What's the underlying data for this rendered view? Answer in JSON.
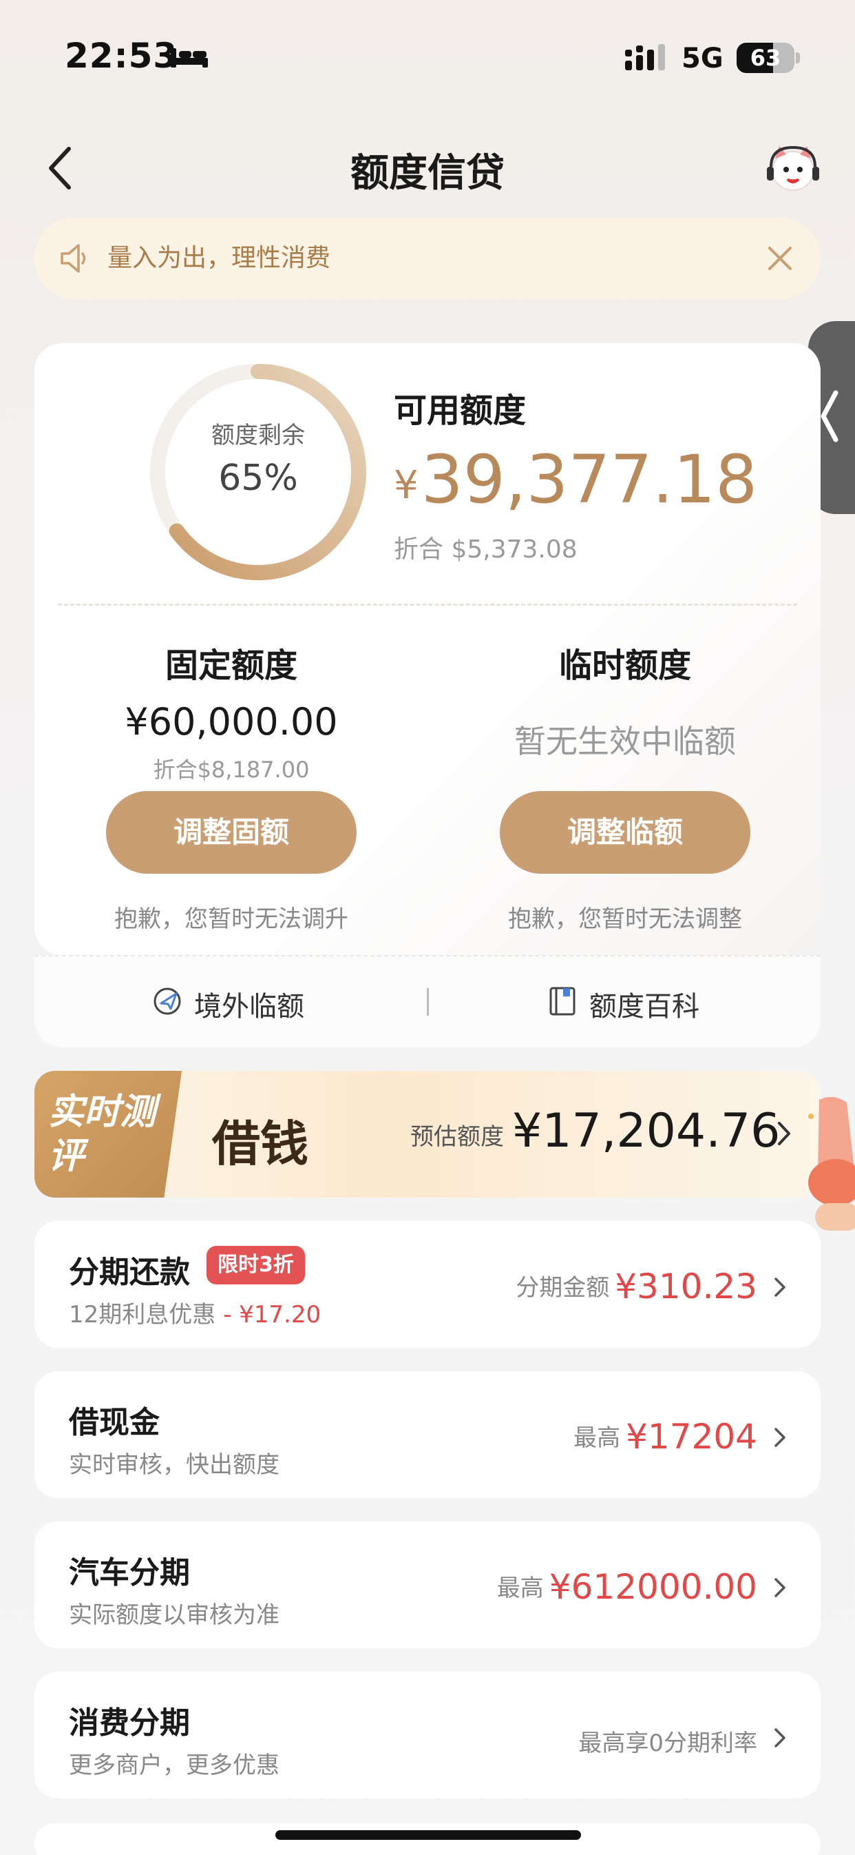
{
  "status_bar": {
    "time": "22:53",
    "network": "5G",
    "battery": "63",
    "battery_level": 0.63
  },
  "header": {
    "title": "额度信贷"
  },
  "notice": {
    "text": "量入为出，理性消费"
  },
  "credit": {
    "ring_label": "额度剩余",
    "ring_value": "65%",
    "ring_fraction": 0.65,
    "available_label": "可用额度",
    "available_currency": "¥",
    "available_value": "39,377.18",
    "available_converted": "折合  $5,373.08",
    "fixed": {
      "title": "固定额度",
      "value": "¥60,000.00",
      "converted": "折合$8,187.00",
      "button": "调整固额",
      "note": "抱歉，您暂时无法调升"
    },
    "temporary": {
      "title": "临时额度",
      "status": "暂无生效中临额",
      "button": "调整临额",
      "note": "抱歉，您暂时无法调整"
    }
  },
  "quick_links": {
    "overseas": "境外临额",
    "wiki": "额度百科"
  },
  "promo": {
    "tag": "实时测评",
    "title": "借钱",
    "estimate_label": "预估额度",
    "estimate_value": "¥17,204.76"
  },
  "products": [
    {
      "title": "分期还款",
      "badge": "限时3折",
      "subtitle": "12期利息优惠",
      "discount": " - ¥17.20",
      "right_label": "分期金额",
      "right_value": "¥310.23"
    },
    {
      "title": "借现金",
      "subtitle": "实时审核，快出额度",
      "right_label": "最高",
      "right_value": "¥17204"
    },
    {
      "title": "汽车分期",
      "subtitle": "实际额度以审核为准",
      "right_label": "最高",
      "right_value": "¥612000.00"
    },
    {
      "title": "消费分期",
      "subtitle": "更多商户，更多优惠",
      "right_label": "最高享0分期利率"
    }
  ],
  "colors": {
    "accent": "#c89e72",
    "gold_text": "#b8895b",
    "red": "#e14848"
  }
}
